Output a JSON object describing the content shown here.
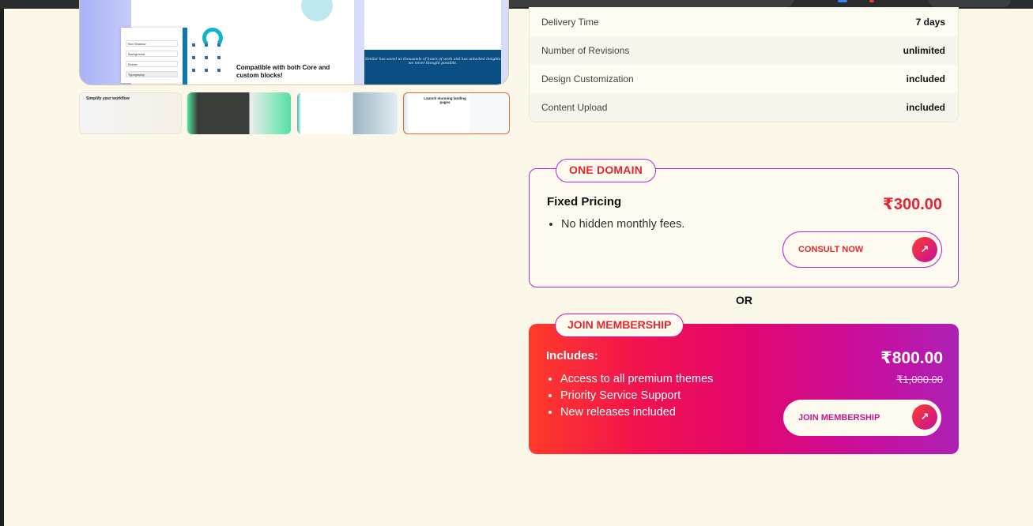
{
  "gallery": {
    "main_image": {
      "caption": "Compatible with both Core and custom blocks!",
      "panel_rows": [
        "Box Shadow",
        "Background",
        "Border",
        "Typography"
      ],
      "quote": "Similar has saved us thousands of hours of work and has unlocked insights we never thought possible."
    },
    "thumbnails": [
      {
        "label": "thumbnail-1",
        "text": "Simplify your workflow"
      },
      {
        "label": "thumbnail-2",
        "text": ""
      },
      {
        "label": "thumbnail-3",
        "text": ""
      },
      {
        "label": "thumbnail-4",
        "text": "Launch stunning landing pages"
      }
    ]
  },
  "specs": [
    {
      "key": "Delivery Time",
      "value": "7 days"
    },
    {
      "key": "Number of Revisions",
      "value": "unlimited"
    },
    {
      "key": "Design Customization",
      "value": "included"
    },
    {
      "key": "Content Upload",
      "value": "included"
    }
  ],
  "plan_one": {
    "tag": "ONE DOMAIN",
    "title": "Fixed Pricing",
    "features": [
      "No hidden monthly fees."
    ],
    "price": "₹300.00",
    "button": "CONSULT NOW"
  },
  "separator": "OR",
  "plan_two": {
    "tag": "JOIN MEMBERSHIP",
    "title": "Includes:",
    "features": [
      "Access to all premium themes",
      "Priority Service Support",
      "New releases included"
    ],
    "price": "₹800.00",
    "old_price": "₹1,000.00",
    "button": "JOIN MEMBERSHIP"
  },
  "colors": {
    "background": "#fbf8ea",
    "accent_red": "#e3262f",
    "accent_purple": "#b629c9",
    "gradient_start": "#ff3b2a",
    "gradient_end": "#ad21b5"
  },
  "icons": {
    "button_arrow": "arrow-up-right-icon"
  }
}
